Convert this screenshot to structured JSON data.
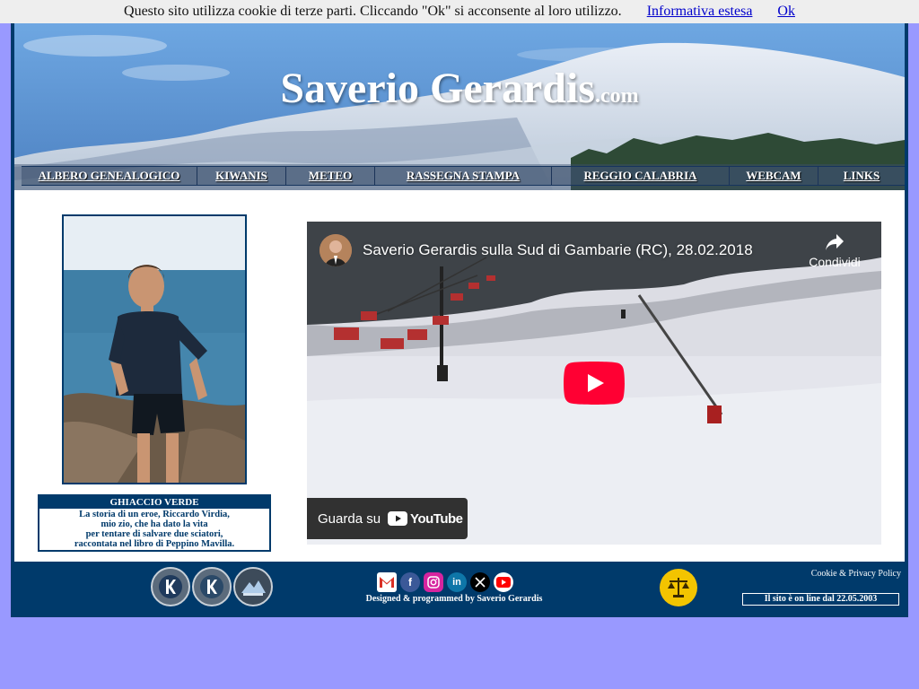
{
  "cookie_bar": {
    "message": "Questo sito utilizza cookie di terze parti. Cliccando \"Ok\" si acconsente al loro utilizzo.",
    "link_label": "Informativa estesa",
    "ok_label": "Ok"
  },
  "header": {
    "title": "Saverio Gerardis",
    "domain_suffix": ".com"
  },
  "nav": {
    "items": [
      {
        "label": "ALBERO GENEALOGICO"
      },
      {
        "label": "KIWANIS"
      },
      {
        "label": "METEO"
      },
      {
        "label": "RASSEGNA STAMPA"
      },
      {
        "label": "REGGIO CALABRIA"
      },
      {
        "label": "WEBCAM"
      },
      {
        "label": "LINKS"
      }
    ]
  },
  "sidebar": {
    "caption_title": "GHIACCIO VERDE",
    "caption_text": "La storia di un eroe, Riccardo Virdia,\nmio zio, che ha dato la vita\nper tentare di salvare due sciatori,\nraccontata nel libro di Peppino Mavilla."
  },
  "video": {
    "title": "Saverio Gerardis sulla Sud di Gambarie (RC), 28.02.2018",
    "share_label": "Condividi",
    "watch_on_label": "Guarda su",
    "youtube_label": "YouTube"
  },
  "footer": {
    "badges": [
      "kiwanis-international-badge",
      "kiwanis-junior-badge",
      "kiwanis-mountain-badge"
    ],
    "social": [
      {
        "icon": "gmail-icon",
        "color": "#ffffff"
      },
      {
        "icon": "facebook-icon",
        "color": "#3b5998"
      },
      {
        "icon": "instagram-icon",
        "color": "#d6249f"
      },
      {
        "icon": "linkedin-icon",
        "color": "#0e76a8"
      },
      {
        "icon": "x-icon",
        "color": "#000000"
      },
      {
        "icon": "youtube-icon",
        "color": "#ffffff"
      }
    ],
    "designed_by": "Designed & programmed by Saverio Gerardis",
    "cookie_policy_label": "Cookie & Privacy Policy",
    "online_since": "Il sito è on line dal 22.05.2003"
  },
  "colors": {
    "page_background": "#9999ff",
    "frame_navy": "#003a6b",
    "cookie_bar_bg": "#eeeeee",
    "youtube_red": "#ff0000"
  }
}
